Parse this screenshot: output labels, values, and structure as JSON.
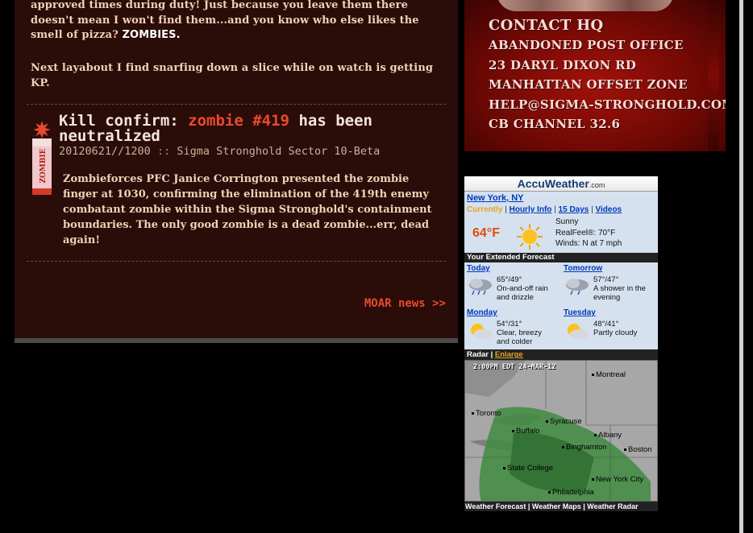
{
  "article_top": {
    "para1": "approved times during duty! Just because you leave them there doesn't mean I won't find them...and you know who else likes the smell of pizza?",
    "para1_emph": "ZOMBIES.",
    "para2": "Next layabout I find snarfing down a slice while on watch is getting KP."
  },
  "news_item": {
    "badge_label": "ZOMBIE",
    "headline_prefix": "Kill confirm:",
    "headline_zombie": "zombie #419",
    "headline_suffix": "has been neutralized",
    "date": "20120621//1200",
    "separator": "::",
    "location": "Sigma Stronghold Sector 10-Beta",
    "body": "Zombieforces PFC Janice Corrington presented the zombie finger at 1030, confirming the elimination of the 419th enemy combatant zombie within the Sigma Stronghold's containment boundaries. The only good zombie is a dead zombie...err, dead again!"
  },
  "more_link": "MOAR news >>",
  "contact": {
    "title": "CONTACT HQ",
    "line1": "ABANDONED POST OFFICE",
    "line2": "23 DARYL DIXON RD",
    "line3": "MANHATTAN OFFSET ZONE",
    "email": "HELP@SIGMA-STRONGHOLD.COM",
    "radio": "CB CHANNEL 32.6"
  },
  "weather": {
    "brand": "AccuWeather",
    "brand_suffix": ".com",
    "city": "New York, NY",
    "tab_current": "Currently",
    "link_hourly": "Hourly Info",
    "link_15days": "15 Days",
    "link_videos": "Videos",
    "temp": "64°F",
    "condition": "Sunny",
    "realfeel": "RealFeel®: 70°F",
    "winds": "Winds: N at 7 mph",
    "extended_title": "Your Extended Forecast",
    "forecast": [
      {
        "day": "Today",
        "temps": "65°/49°",
        "desc1": "On-and-off rain",
        "desc2": "and drizzle"
      },
      {
        "day": "Tomorrow",
        "temps": "57°/47°",
        "desc1": "A shower in the",
        "desc2": "evening"
      },
      {
        "day": "Monday",
        "temps": "54°/31°",
        "desc1": "Clear, breezy",
        "desc2": "and colder"
      },
      {
        "day": "Tuesday",
        "temps": "48°/41°",
        "desc1": "Partly cloudy",
        "desc2": ""
      }
    ],
    "radar_label": "Radar",
    "enlarge_label": "Enlarge",
    "radar_stamp": "2:00PM EDT 24-MAR-12",
    "cities": [
      "Montreal",
      "Toronto",
      "Syracuse",
      "Albany",
      "Buffalo",
      "Binghamton",
      "Boston",
      "State College",
      "New York City",
      "Philadelphia"
    ],
    "footer": [
      "Weather Forecast",
      "Weather Maps",
      "Weather Radar"
    ]
  },
  "colors": {
    "panel_bg": "#2a0c08",
    "accent_red": "#e84a2e",
    "body_text": "#f1d1b8"
  }
}
